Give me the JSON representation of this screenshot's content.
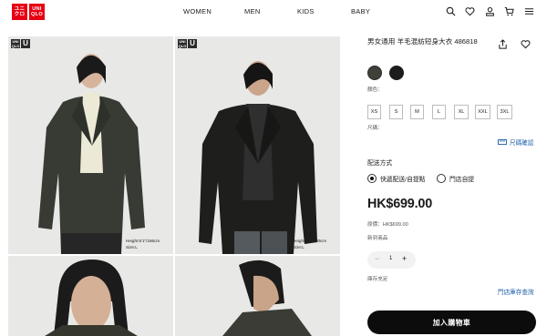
{
  "header": {
    "logo_text": [
      "ユニ",
      "クロ"
    ],
    "logo_text_latin": [
      "UNI",
      "QLO"
    ],
    "nav": [
      "WOMEN",
      "MEN",
      "KIDS",
      "BABY"
    ],
    "icons": [
      "search-icon",
      "heart-icon",
      "account-icon",
      "cart-icon",
      "menu-icon"
    ]
  },
  "gallery": {
    "badge_text": "UNI QLO",
    "badge_letter": "U",
    "captions": [
      {
        "height": "Height:6'1\"/186cm",
        "size": "Size:L"
      },
      {
        "height": "Height:6'1\"/185cm",
        "size": "Size:L"
      }
    ]
  },
  "product": {
    "title": "男女通用 羊毛混紡短身大衣 486818",
    "color_label": "顏色：",
    "colors": [
      "#3f4039",
      "#1c1c1c"
    ],
    "size_label": "尺碼：",
    "sizes": [
      "XS",
      "S",
      "M",
      "L",
      "XL",
      "XXL",
      "3XL"
    ],
    "size_guide": "尺碼確認",
    "delivery_heading": "配送方式",
    "delivery_options": [
      "快遞配送/自提點",
      "門店自提"
    ],
    "delivery_selected": 0,
    "price": "HK$699.00",
    "original_price": "原價：HK$699.00",
    "tag": "新到商品",
    "quantity": "1",
    "stock_status": "庫存充足",
    "store_link": "門店庫存查詢",
    "add_to_cart": "加入購物車"
  },
  "colors": {
    "brand_red": "#e60012",
    "link_blue": "#1b5fa6",
    "button_black": "#0c0c0c"
  }
}
